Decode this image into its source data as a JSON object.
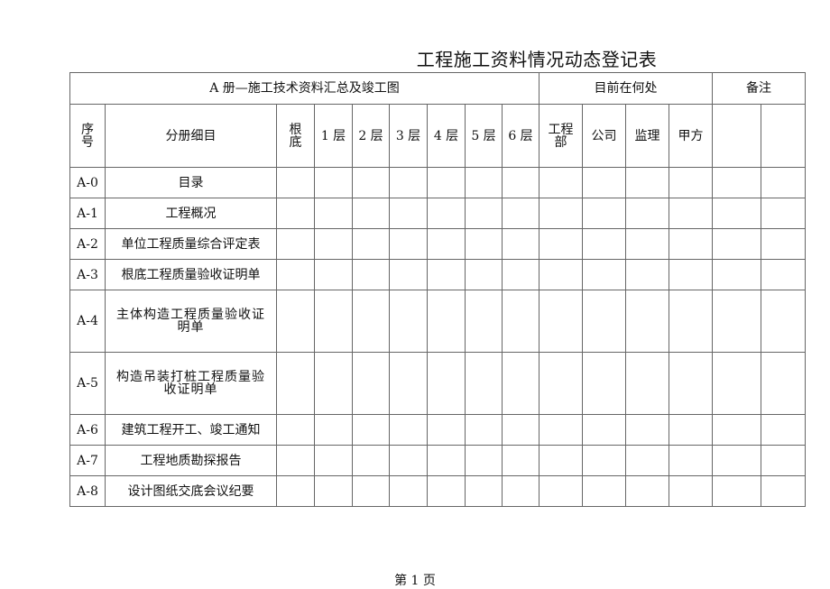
{
  "document": {
    "title": "工程施工资料情况动态登记表",
    "footer": "第 1 页"
  },
  "table": {
    "group_headers": {
      "volume": "A 册—施工技术资料汇总及竣工图",
      "location": "目前在何处",
      "remarks": "备注"
    },
    "columns": {
      "seq": [
        "序",
        "号"
      ],
      "item": "分册细目",
      "foundation": [
        "根",
        "底"
      ],
      "floors": [
        "1 层",
        "2 层",
        "3 层",
        "4 层",
        "5 层",
        "6 层"
      ],
      "project_dept": [
        "工程",
        "部"
      ],
      "company": "公司",
      "supervisor": "监理",
      "owner": "甲方"
    },
    "rows": [
      {
        "code": "A-0",
        "lines": [
          "目录"
        ]
      },
      {
        "code": "A-1",
        "lines": [
          "工程概况"
        ]
      },
      {
        "code": "A-2",
        "lines": [
          "单位工程质量综合评定表"
        ]
      },
      {
        "code": "A-3",
        "lines": [
          "根底工程质量验收证明单"
        ]
      },
      {
        "code": "A-4",
        "lines": [
          "主体构造工程质量验收证",
          "明单"
        ]
      },
      {
        "code": "A-5",
        "lines": [
          "构造吊装打桩工程质量验",
          "收证明单"
        ]
      },
      {
        "code": "A-6",
        "lines": [
          "建筑工程开工、竣工通知"
        ]
      },
      {
        "code": "A-7",
        "lines": [
          "工程地质勘探报告"
        ]
      },
      {
        "code": "A-8",
        "lines": [
          "设计图纸交底会议纪要"
        ]
      }
    ]
  }
}
